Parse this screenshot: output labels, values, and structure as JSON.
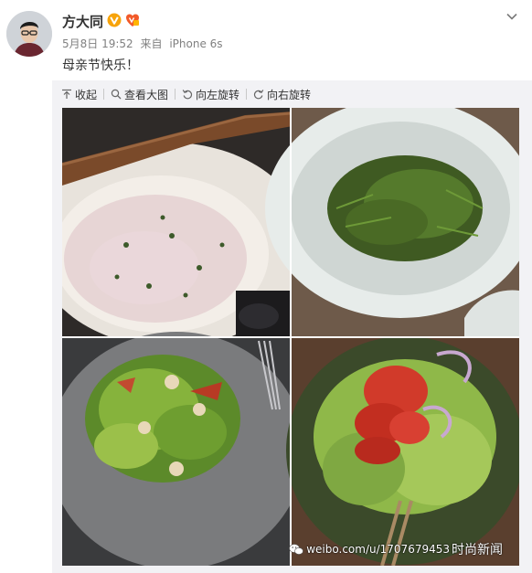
{
  "post": {
    "username": "方大同",
    "date": "5月8日 19:52",
    "source_prefix": "来自",
    "source": "iPhone 6s",
    "text": "母亲节快乐！"
  },
  "toolbar": {
    "collapse_label": "收起",
    "view_large_label": "查看大图",
    "rotate_left_label": "向左旋转",
    "rotate_right_label": "向右旋转"
  },
  "watermark": {
    "site": "weibo.com/u/1707679453",
    "handle": "时尚新闻"
  },
  "icons": {
    "verified": "verified-v-icon",
    "vip": "vip-badge-icon",
    "menu": "chevron-down-icon",
    "collapse": "collapse-arrow-icon",
    "zoom": "magnifier-icon",
    "rotate_left": "rotate-left-icon",
    "rotate_right": "rotate-right-icon",
    "wechat": "wechat-icon"
  },
  "colors": {
    "verified": "#f7a30a",
    "vip": "#f25a29",
    "text": "#333333",
    "meta": "#808080",
    "media_bg": "#f2f2f5"
  }
}
